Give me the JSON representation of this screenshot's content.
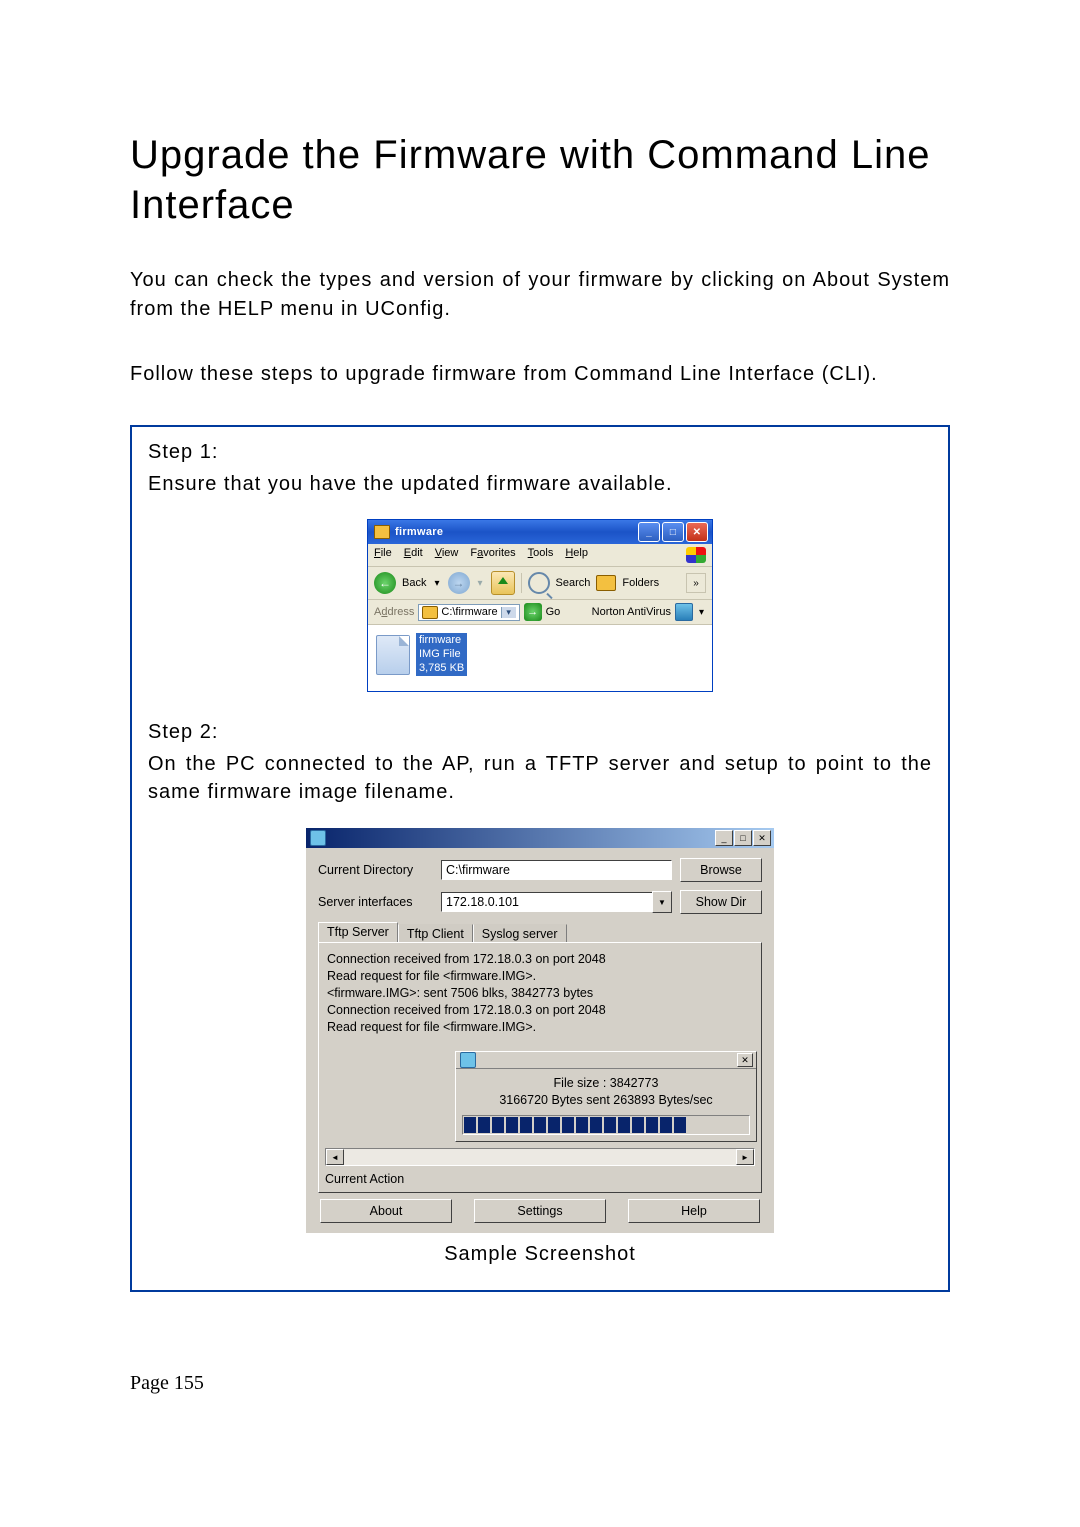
{
  "doc": {
    "title": "Upgrade the Firmware with Command Line Interface",
    "p1": "You can check the types and version of your firmware by clicking on About System from the HELP menu in UConfig.",
    "p2": "Follow these steps to upgrade firmware from Command Line Interface (CLI).",
    "pagenum": "Page 155"
  },
  "step1": {
    "label": "Step 1:",
    "text": "Ensure that you have the updated firmware available."
  },
  "step2": {
    "label": "Step 2:",
    "text": "On the PC connected to the AP, run a TFTP server and setup to point to the same firmware image filename.",
    "caption": "Sample Screenshot"
  },
  "explorer": {
    "title": "firmware",
    "menu": {
      "file": "File",
      "edit": "Edit",
      "view": "View",
      "favorites": "Favorites",
      "tools": "Tools",
      "help": "Help"
    },
    "toolbar": {
      "back": "Back",
      "search": "Search",
      "folders": "Folders"
    },
    "address_label": "Address",
    "address_value": "C:\\firmware",
    "go": "Go",
    "av": "Norton AntiVirus",
    "file": {
      "name": "firmware",
      "type": "IMG File",
      "size": "3,785 KB"
    }
  },
  "tftp": {
    "rows": {
      "dir_label": "Current Directory",
      "dir_value": "C:\\firmware",
      "browse": "Browse",
      "if_label": "Server interfaces",
      "if_value": "172.18.0.101",
      "showdir": "Show Dir"
    },
    "tabs": {
      "t1": "Tftp Server",
      "t2": "Tftp Client",
      "t3": "Syslog server"
    },
    "log": "Connection received from 172.18.0.3 on port 2048\nRead request for file <firmware.IMG>.\n<firmware.IMG>: sent 7506 blks, 3842773 bytes\nConnection received from 172.18.0.3 on port 2048\nRead request for file <firmware.IMG>.",
    "popup": {
      "line1": "File size : 3842773",
      "line2": "3166720 Bytes sent   263893 Bytes/sec"
    },
    "current_action": "Current Action",
    "footer": {
      "about": "About",
      "settings": "Settings",
      "help": "Help"
    }
  }
}
